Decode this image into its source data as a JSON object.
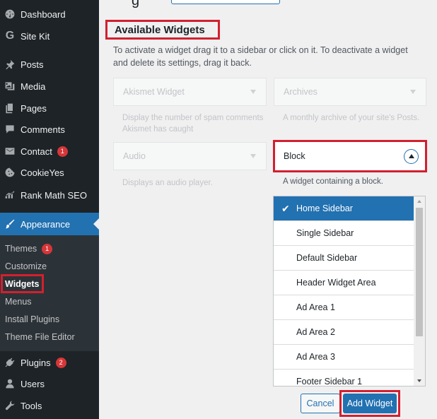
{
  "sidebar": {
    "items": [
      {
        "label": "Dashboard",
        "icon": "dashboard-icon"
      },
      {
        "label": "Site Kit",
        "icon": "site-kit-icon"
      },
      {
        "label": "Posts",
        "icon": "pin-icon"
      },
      {
        "label": "Media",
        "icon": "media-icon"
      },
      {
        "label": "Pages",
        "icon": "pages-icon"
      },
      {
        "label": "Comments",
        "icon": "comment-icon"
      },
      {
        "label": "Contact",
        "icon": "envelope-icon",
        "badge": "1"
      },
      {
        "label": "CookieYes",
        "icon": "cookie-icon"
      },
      {
        "label": "Rank Math SEO",
        "icon": "rank-math-icon"
      }
    ],
    "appearance": {
      "label": "Appearance",
      "icon": "paintbrush-icon"
    },
    "submenu": [
      {
        "label": "Themes",
        "badge": "1"
      },
      {
        "label": "Customize"
      },
      {
        "label": "Widgets"
      },
      {
        "label": "Menus"
      },
      {
        "label": "Install Plugins"
      },
      {
        "label": "Theme File Editor"
      }
    ],
    "bottom_items": [
      {
        "label": "Plugins",
        "icon": "plugin-icon",
        "badge": "2"
      },
      {
        "label": "Users",
        "icon": "user-icon"
      },
      {
        "label": "Tools",
        "icon": "wrench-icon"
      }
    ]
  },
  "main": {
    "page_title_fragment": "g",
    "available_widgets_title": "Available Widgets",
    "available_widgets_description": "To activate a widget drag it to a sidebar or click on it. To deactivate a widget and delete its settings, drag it back.",
    "widgets": [
      {
        "name": "Akismet Widget",
        "description": "Display the number of spam comments Akismet has caught"
      },
      {
        "name": "Archives",
        "description": "A monthly archive of your site's Posts."
      },
      {
        "name": "Audio",
        "description": "Displays an audio player."
      }
    ],
    "block_widget": {
      "name": "Block",
      "description": "A widget containing a block."
    },
    "sidebar_options": [
      "Home Sidebar",
      "Single Sidebar",
      "Default Sidebar",
      "Header Widget Area",
      "Ad Area 1",
      "Ad Area 2",
      "Ad Area 3",
      "Footer Sidebar 1"
    ],
    "selected_option": "Home Sidebar",
    "cancel_label": "Cancel",
    "add_widget_label": "Add Widget"
  },
  "colors": {
    "accent": "#2271b1",
    "sidebar_bg": "#1d2327",
    "submenu_bg": "#2c3338",
    "badge": "#d63638",
    "highlight": "#d2202f"
  }
}
